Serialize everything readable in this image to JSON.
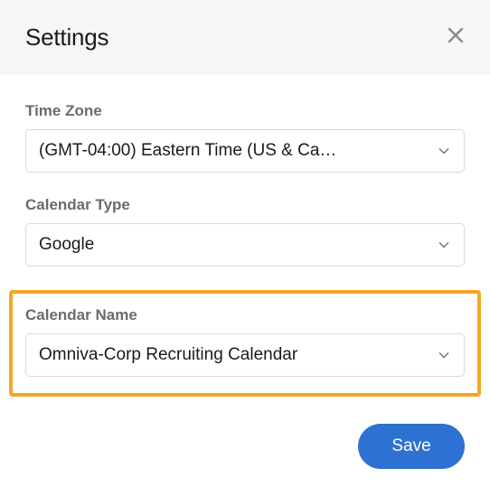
{
  "header": {
    "title": "Settings"
  },
  "fields": {
    "timezone": {
      "label": "Time Zone",
      "value": "(GMT-04:00) Eastern Time (US & Ca…"
    },
    "calendar_type": {
      "label": "Calendar Type",
      "value": "Google"
    },
    "calendar_name": {
      "label": "Calendar Name",
      "value": "Omniva-Corp Recruiting Calendar"
    }
  },
  "footer": {
    "save_label": "Save"
  }
}
